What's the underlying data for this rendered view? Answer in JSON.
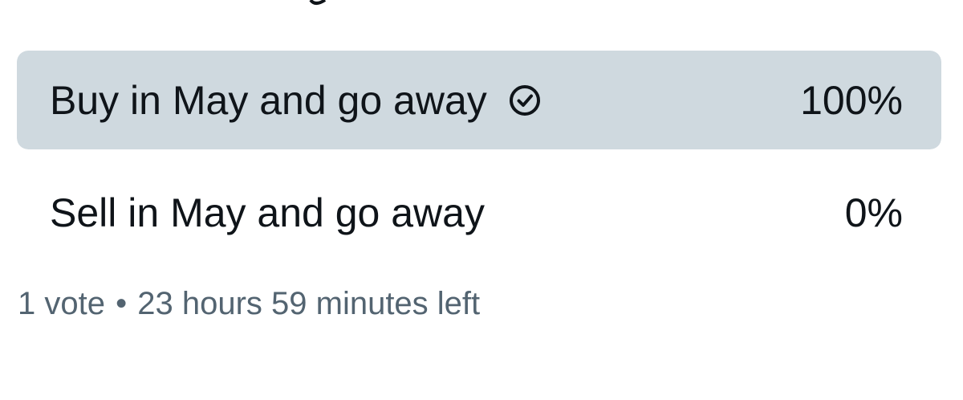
{
  "colors": {
    "winner_fill": "#cfd9df",
    "text": "#0f1419",
    "meta_text": "#536471"
  },
  "poll": {
    "options": [
      {
        "label": "Buy in May and go away",
        "percent_text": "100%",
        "share": 1.0,
        "winner": true,
        "icon": "check-circle-icon"
      },
      {
        "label": "Sell in May and go away",
        "percent_text": "0%",
        "share": 0.0,
        "winner": false
      }
    ],
    "meta": {
      "votes": "1 vote",
      "separator": "•",
      "time_left": "23 hours 59 minutes left"
    }
  }
}
